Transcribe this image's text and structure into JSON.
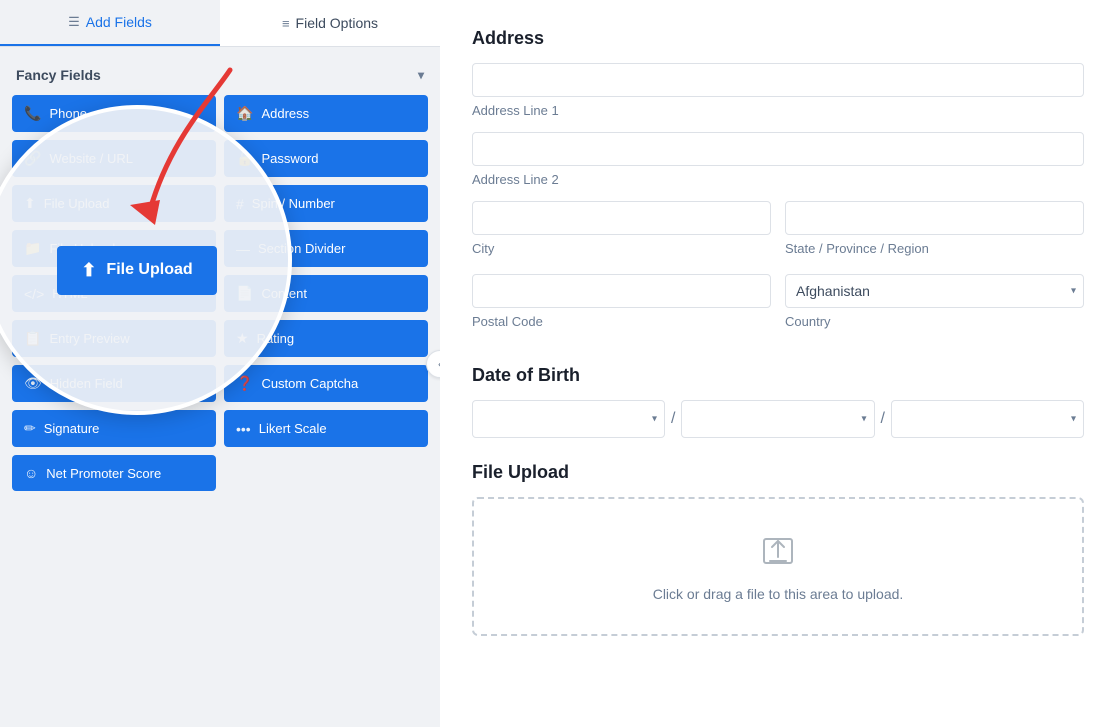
{
  "tabs": [
    {
      "id": "add-fields",
      "label": "Add Fields",
      "icon": "☰",
      "active": true
    },
    {
      "id": "field-options",
      "label": "Field Options",
      "icon": "≡",
      "active": false
    }
  ],
  "sidebar": {
    "fancy_fields_label": "Fancy Fields",
    "buttons": [
      {
        "id": "phone",
        "label": "Phone",
        "icon": "📞",
        "fullWidth": false
      },
      {
        "id": "address",
        "label": "Address",
        "icon": "🏠",
        "fullWidth": false
      },
      {
        "id": "website",
        "label": "Website / URL",
        "icon": "🔗",
        "fullWidth": false
      },
      {
        "id": "password",
        "label": "Password",
        "icon": "🔒",
        "fullWidth": false
      },
      {
        "id": "fileupload",
        "label": "File Upload",
        "icon": "⬆",
        "fullWidth": false
      },
      {
        "id": "spinbutton",
        "label": "Spin / Number",
        "icon": "🔢",
        "fullWidth": false
      },
      {
        "id": "section",
        "label": "Section Divider",
        "icon": "📋",
        "fullWidth": false
      },
      {
        "id": "fileupload2",
        "label": "File Upload",
        "icon": "📁",
        "fullWidth": false
      },
      {
        "id": "html",
        "label": "HTML",
        "icon": "</>",
        "fullWidth": false
      },
      {
        "id": "content",
        "label": "Content",
        "icon": "📄",
        "fullWidth": false
      },
      {
        "id": "entry-preview",
        "label": "Entry Preview",
        "icon": "📋",
        "fullWidth": false
      },
      {
        "id": "rating",
        "label": "Rating",
        "icon": "★",
        "fullWidth": false
      },
      {
        "id": "hidden-field",
        "label": "Hidden Field",
        "icon": "👁",
        "fullWidth": false
      },
      {
        "id": "custom-captcha",
        "label": "Custom Captcha",
        "icon": "❓",
        "fullWidth": false
      },
      {
        "id": "signature",
        "label": "Signature",
        "icon": "✏",
        "fullWidth": false
      },
      {
        "id": "likert",
        "label": "Likert Scale",
        "icon": "•••",
        "fullWidth": false
      },
      {
        "id": "nps",
        "label": "Net Promoter Score",
        "icon": "☺",
        "fullWidth": false
      }
    ],
    "circle_highlight": {
      "label": "File Upload",
      "icon": "⬆"
    }
  },
  "form": {
    "address_section": {
      "title": "Address",
      "line1_label": "Address Line 1",
      "line2_label": "Address Line 2",
      "city_label": "City",
      "state_label": "State / Province / Region",
      "postal_label": "Postal Code",
      "country_label": "Country",
      "country_default": "Afghanistan"
    },
    "dob_section": {
      "title": "Date of Birth"
    },
    "file_section": {
      "title": "File Upload",
      "upload_text": "Click or drag a file to this area to upload."
    }
  },
  "collapse_btn_label": "‹"
}
